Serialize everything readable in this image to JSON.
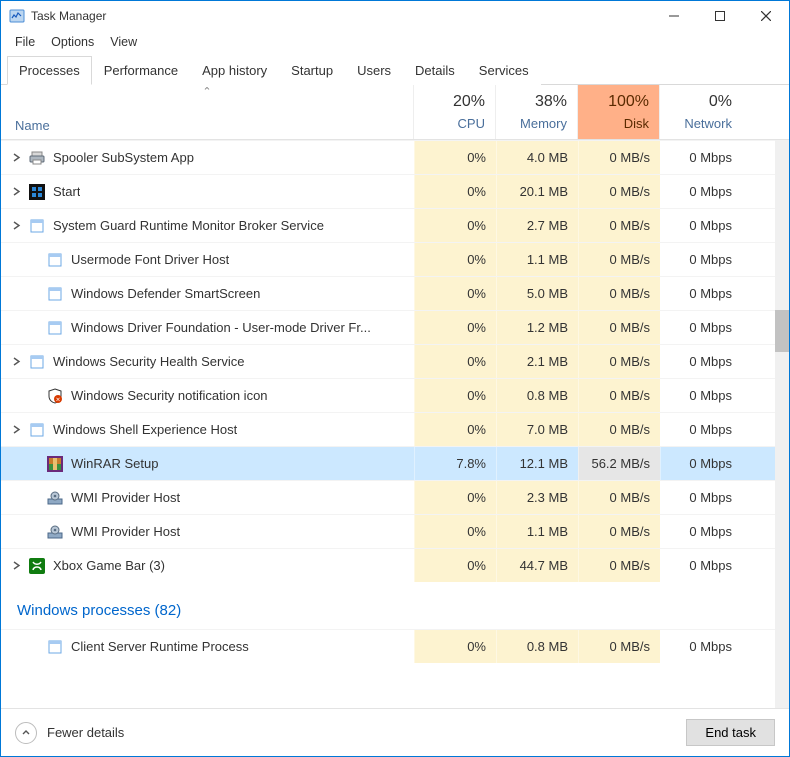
{
  "window": {
    "title": "Task Manager"
  },
  "menu": [
    "File",
    "Options",
    "View"
  ],
  "tabs": [
    "Processes",
    "Performance",
    "App history",
    "Startup",
    "Users",
    "Details",
    "Services"
  ],
  "activeTab": 0,
  "columns": {
    "nameLabel": "Name",
    "cols": [
      {
        "label": "CPU",
        "pct": "20%"
      },
      {
        "label": "Memory",
        "pct": "38%"
      },
      {
        "label": "Disk",
        "pct": "100%"
      },
      {
        "label": "Network",
        "pct": "0%"
      }
    ]
  },
  "rows": [
    {
      "expandable": true,
      "indent": false,
      "icon": "printer-icon",
      "name": "Spooler SubSystem App",
      "cpu": "0%",
      "mem": "4.0 MB",
      "disk": "0 MB/s",
      "net": "0 Mbps",
      "selected": false
    },
    {
      "expandable": true,
      "indent": false,
      "icon": "start-tile-icon",
      "name": "Start",
      "cpu": "0%",
      "mem": "20.1 MB",
      "disk": "0 MB/s",
      "net": "0 Mbps",
      "selected": false
    },
    {
      "expandable": true,
      "indent": false,
      "icon": "app-window-icon",
      "name": "System Guard Runtime Monitor Broker Service",
      "cpu": "0%",
      "mem": "2.7 MB",
      "disk": "0 MB/s",
      "net": "0 Mbps",
      "selected": false
    },
    {
      "expandable": false,
      "indent": true,
      "icon": "app-window-icon",
      "name": "Usermode Font Driver Host",
      "cpu": "0%",
      "mem": "1.1 MB",
      "disk": "0 MB/s",
      "net": "0 Mbps",
      "selected": false
    },
    {
      "expandable": false,
      "indent": true,
      "icon": "app-window-icon",
      "name": "Windows Defender SmartScreen",
      "cpu": "0%",
      "mem": "5.0 MB",
      "disk": "0 MB/s",
      "net": "0 Mbps",
      "selected": false
    },
    {
      "expandable": false,
      "indent": true,
      "icon": "app-window-icon",
      "name": "Windows Driver Foundation - User-mode Driver Fr...",
      "cpu": "0%",
      "mem": "1.2 MB",
      "disk": "0 MB/s",
      "net": "0 Mbps",
      "selected": false
    },
    {
      "expandable": true,
      "indent": false,
      "icon": "app-window-icon",
      "name": "Windows Security Health Service",
      "cpu": "0%",
      "mem": "2.1 MB",
      "disk": "0 MB/s",
      "net": "0 Mbps",
      "selected": false
    },
    {
      "expandable": false,
      "indent": true,
      "icon": "shield-alert-icon",
      "name": "Windows Security notification icon",
      "cpu": "0%",
      "mem": "0.8 MB",
      "disk": "0 MB/s",
      "net": "0 Mbps",
      "selected": false
    },
    {
      "expandable": true,
      "indent": false,
      "icon": "app-window-icon",
      "name": "Windows Shell Experience Host",
      "cpu": "0%",
      "mem": "7.0 MB",
      "disk": "0 MB/s",
      "net": "0 Mbps",
      "selected": false
    },
    {
      "expandable": false,
      "indent": true,
      "icon": "winrar-icon",
      "name": "WinRAR Setup",
      "cpu": "7.8%",
      "mem": "12.1 MB",
      "disk": "56.2 MB/s",
      "net": "0 Mbps",
      "selected": true
    },
    {
      "expandable": false,
      "indent": true,
      "icon": "gear-stack-icon",
      "name": "WMI Provider Host",
      "cpu": "0%",
      "mem": "2.3 MB",
      "disk": "0 MB/s",
      "net": "0 Mbps",
      "selected": false
    },
    {
      "expandable": false,
      "indent": true,
      "icon": "gear-stack-icon",
      "name": "WMI Provider Host",
      "cpu": "0%",
      "mem": "1.1 MB",
      "disk": "0 MB/s",
      "net": "0 Mbps",
      "selected": false
    },
    {
      "expandable": true,
      "indent": false,
      "icon": "xbox-icon",
      "name": "Xbox Game Bar (3)",
      "cpu": "0%",
      "mem": "44.7 MB",
      "disk": "0 MB/s",
      "net": "0 Mbps",
      "selected": false
    }
  ],
  "groupHeading": "Windows processes (82)",
  "rows2": [
    {
      "expandable": false,
      "indent": true,
      "icon": "app-window-icon",
      "name": "Client Server Runtime Process",
      "cpu": "0%",
      "mem": "0.8 MB",
      "disk": "0 MB/s",
      "net": "0 Mbps",
      "selected": false
    }
  ],
  "footer": {
    "fewerDetails": "Fewer details",
    "endTask": "End task"
  }
}
